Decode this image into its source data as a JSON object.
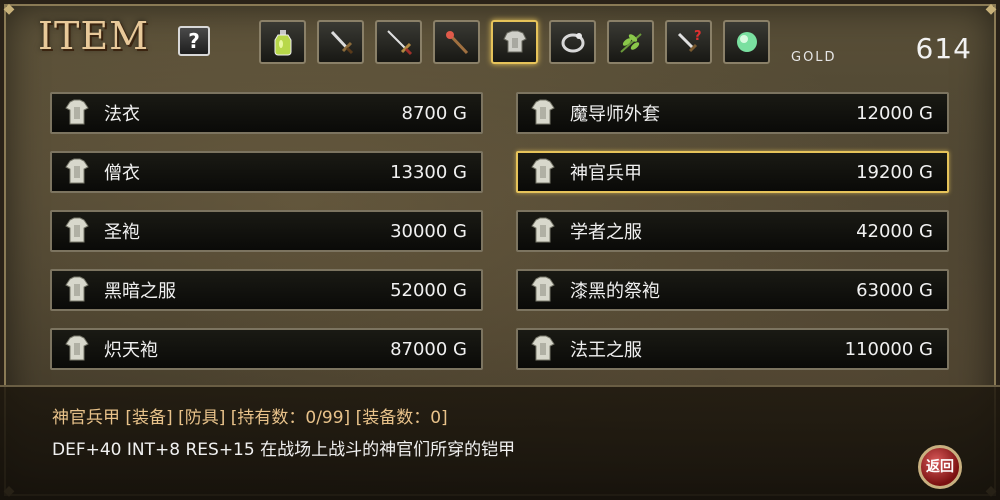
{
  "header": {
    "title": "ITEM",
    "help_label": "?",
    "gold_label": "GOLD",
    "gold_value": "614"
  },
  "tabs": [
    {
      "icon": "potion-icon"
    },
    {
      "icon": "sword-icon"
    },
    {
      "icon": "rapier-icon"
    },
    {
      "icon": "staff-icon"
    },
    {
      "icon": "armor-icon",
      "active": true
    },
    {
      "icon": "ring-icon"
    },
    {
      "icon": "herb-icon"
    },
    {
      "icon": "unknown-weapon-icon"
    },
    {
      "icon": "orb-icon"
    }
  ],
  "items": [
    {
      "name": "法衣",
      "price": "8700 G"
    },
    {
      "name": "魔导师外套",
      "price": "12000 G"
    },
    {
      "name": "僧衣",
      "price": "13300 G"
    },
    {
      "name": "神官兵甲",
      "price": "19200 G",
      "selected": true
    },
    {
      "name": "圣袍",
      "price": "30000 G"
    },
    {
      "name": "学者之服",
      "price": "42000 G"
    },
    {
      "name": "黑暗之服",
      "price": "52000 G"
    },
    {
      "name": "漆黑的祭袍",
      "price": "63000 G"
    },
    {
      "name": "炽天袍",
      "price": "87000 G"
    },
    {
      "name": "法王之服",
      "price": "110000 G"
    }
  ],
  "description": {
    "line1": "神官兵甲 [装备] [防具] [持有数：0/99] [装备数：0]",
    "line2": "DEF+40 INT+8 RES+15 在战场上战斗的神官们所穿的铠甲"
  },
  "back_label": "返回",
  "colors": {
    "accent": "#e6c35a",
    "desc_highlight": "#e8c28a",
    "title": "#e8c99a"
  }
}
